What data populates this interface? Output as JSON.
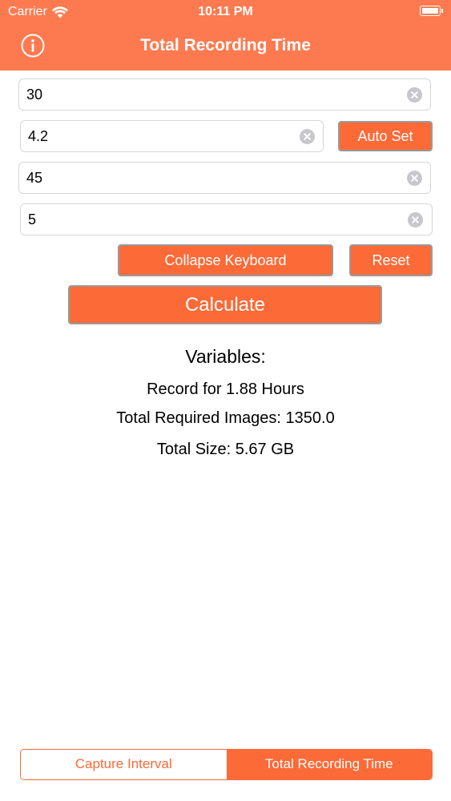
{
  "status_bar": {
    "carrier": "Carrier",
    "time": "10:11 PM",
    "wifi_icon": "wifi-icon",
    "battery_icon": "battery-icon"
  },
  "nav": {
    "title": "Total Recording Time",
    "info_icon": "info-icon"
  },
  "fields": [
    {
      "value": "30",
      "placeholder": ""
    },
    {
      "value": "4.2",
      "placeholder": ""
    },
    {
      "value": "45",
      "placeholder": ""
    },
    {
      "value": "5",
      "placeholder": ""
    }
  ],
  "buttons": {
    "auto_set": "Auto Set",
    "collapse_keyboard": "Collapse Keyboard",
    "reset": "Reset",
    "calculate": "Calculate"
  },
  "results": {
    "title": "Variables:",
    "hours": "Record for 1.88 Hours",
    "images": "Total Required Images: 1350.0",
    "size": "Total Size: 5.67 GB"
  },
  "tabs": [
    {
      "label": "Capture Interval",
      "selected": false
    },
    {
      "label": "Total Recording Time",
      "selected": true
    }
  ],
  "colors": {
    "header": "#fd7a50",
    "accent": "#fb6a37",
    "button_border": "#9a9a9a",
    "clear_icon": "#c7c7cc"
  }
}
